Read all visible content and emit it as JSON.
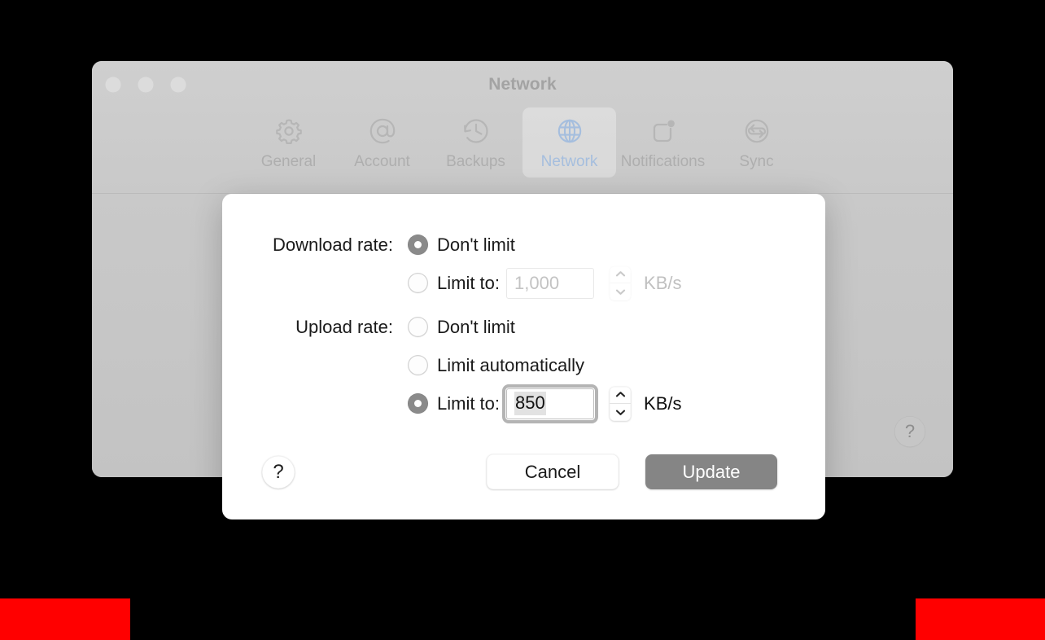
{
  "window": {
    "title": "Network",
    "traffic_lights": [
      "close",
      "minimize",
      "zoom"
    ],
    "background_help_label": "?"
  },
  "toolbar": {
    "items": [
      {
        "id": "general",
        "label": "General",
        "icon": "gear-icon",
        "selected": false
      },
      {
        "id": "account",
        "label": "Account",
        "icon": "at-sign-icon",
        "selected": false
      },
      {
        "id": "backups",
        "label": "Backups",
        "icon": "clock-rewind-icon",
        "selected": false
      },
      {
        "id": "network",
        "label": "Network",
        "icon": "globe-icon",
        "selected": true
      },
      {
        "id": "notifications",
        "label": "Notifications",
        "icon": "notification-badge-icon",
        "selected": false
      },
      {
        "id": "sync",
        "label": "Sync",
        "icon": "refresh-sync-icon",
        "selected": false
      }
    ],
    "selected_color": "#a5bede",
    "label_color": "#aeaeae"
  },
  "sheet": {
    "download": {
      "label": "Download rate:",
      "options": [
        {
          "id": "dont-limit",
          "label": "Don't limit",
          "selected": true
        },
        {
          "id": "limit-to",
          "label": "Limit to:",
          "selected": false
        }
      ],
      "value": "1,000",
      "unit": "KB/s",
      "enabled": false
    },
    "upload": {
      "label": "Upload rate:",
      "options": [
        {
          "id": "dont-limit",
          "label": "Don't limit",
          "selected": false
        },
        {
          "id": "limit-auto",
          "label": "Limit automatically",
          "selected": false
        },
        {
          "id": "limit-to",
          "label": "Limit to:",
          "selected": true
        }
      ],
      "value": "850",
      "unit": "KB/s",
      "enabled": true,
      "focused": true
    },
    "footer": {
      "help_label": "?",
      "cancel_label": "Cancel",
      "update_label": "Update"
    }
  },
  "markers": {
    "red_color": "#ff0000",
    "left_bar": "red-marker-left",
    "right_bar": "red-marker-right"
  }
}
